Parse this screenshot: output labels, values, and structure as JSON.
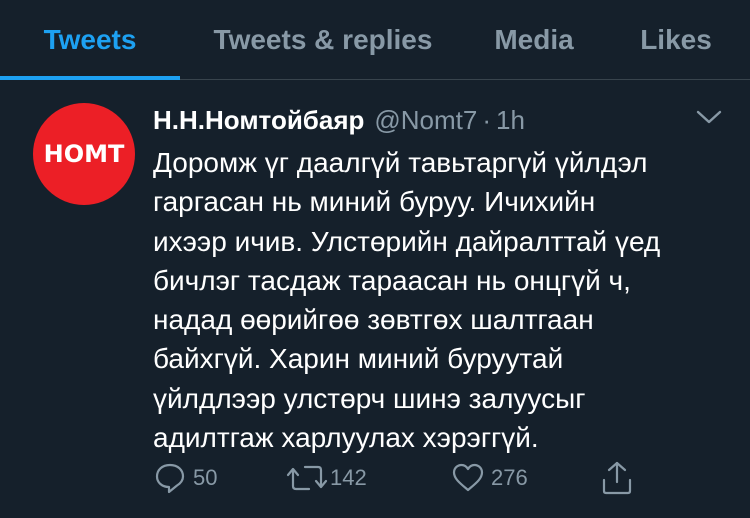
{
  "tabs": [
    {
      "label": "Tweets",
      "active": true
    },
    {
      "label": "Tweets & replies",
      "active": false
    },
    {
      "label": "Media",
      "active": false
    },
    {
      "label": "Likes",
      "active": false
    }
  ],
  "tweet": {
    "avatar_text": "НОМТ",
    "name": "Н.Н.Номтойбаяр",
    "handle": "@Nomt7",
    "separator": "·",
    "time": "1h",
    "text": "Доромж үг даалгүй тавьтаргүй үйлдэл\nгаргасан нь миний буруу. Ичихийн\nихээр ичив. Улстөрийн дайралттай үед\nбичлэг тасдаж тараасан нь онцгүй ч,\nнадад өөрийгөө зөвтгөх шалтгаан\nбайхгүй. Харин миний буруутай\nүйлдлээр улстөрч шинэ залуусыг\nадилтгаж харлуулах хэрэггүй.",
    "replies": "50",
    "retweets": "142",
    "likes": "276"
  },
  "colors": {
    "background": "#15202b",
    "accent": "#1da1f2",
    "muted": "#8899a6",
    "avatar": "#ec1f26",
    "divider": "#38444d"
  },
  "icons": [
    "chevron-down-icon",
    "reply-icon",
    "retweet-icon",
    "like-icon",
    "share-icon"
  ]
}
